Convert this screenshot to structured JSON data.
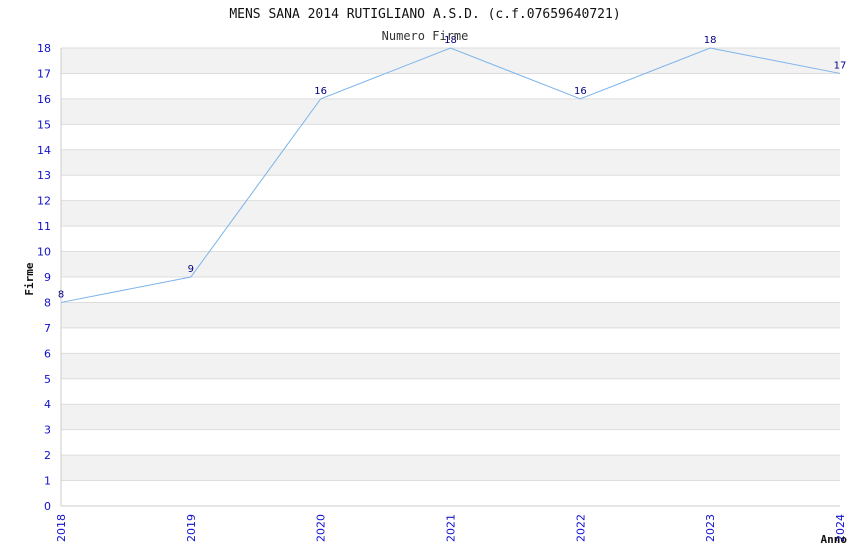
{
  "chart_data": {
    "type": "line",
    "title": "MENS SANA 2014 RUTIGLIANO A.S.D. (c.f.07659640721)",
    "subtitle": "Numero Firme",
    "xlabel": "Anno",
    "ylabel": "Firme",
    "x": [
      "2018",
      "2019",
      "2020",
      "2021",
      "2022",
      "2023",
      "2024"
    ],
    "series": [
      {
        "values": [
          8,
          9,
          16,
          18,
          16,
          18,
          17
        ]
      }
    ],
    "data_labels": [
      "8",
      "9",
      "16",
      "18",
      "16",
      "18",
      "17"
    ],
    "y_ticks": [
      "0",
      "1",
      "2",
      "3",
      "4",
      "5",
      "6",
      "7",
      "8",
      "9",
      "10",
      "11",
      "12",
      "13",
      "14",
      "15",
      "16",
      "17",
      "18"
    ],
    "ylim": [
      0,
      18
    ],
    "grid": true,
    "colors": {
      "line": "#7db4ea",
      "tick_text": "#1111cc",
      "label_text": "#000080",
      "band": "#f2f2f2",
      "gridline": "#dddddd",
      "axis": "#cccccc"
    }
  }
}
